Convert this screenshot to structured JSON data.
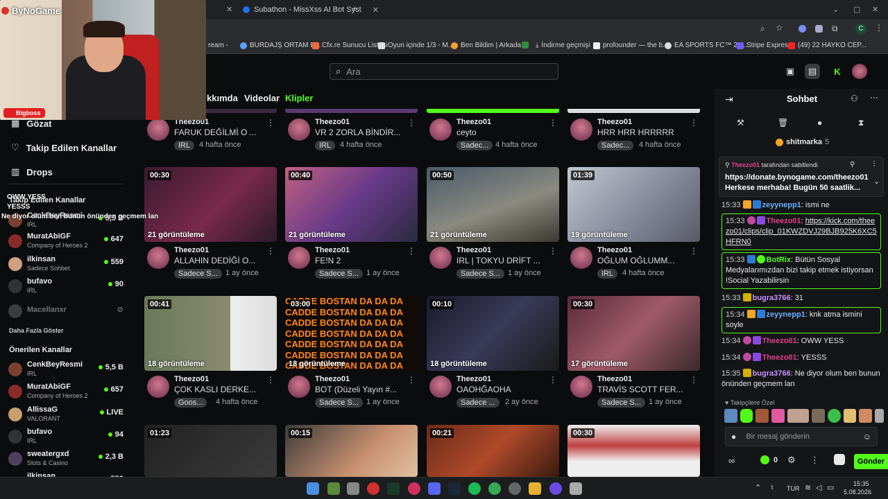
{
  "browser": {
    "tabs": [
      {
        "label": "Subathon - MissXss AI Bot Syst"
      }
    ],
    "new_tab": "+",
    "bookmarks": [
      "ream -",
      "BURDAJŞ ORTAM B...",
      "Cfx.re Sunucu Listesi",
      "Oyun içinde 1/3 - M...",
      "Ben Bildim | Arkada...",
      "İndirme geçmişi",
      "profounder — the b...",
      "EA SPORTS FC™ 24...",
      "Stripe Express",
      "(49) 22 HAYKO CEP..."
    ],
    "profile_letter": "C"
  },
  "header": {
    "search_placeholder": "Ara"
  },
  "overlay": {
    "logo": "ByNoGame",
    "webcam_name": "Bigboss",
    "chat_lines": [
      "OWW YESS",
      "YESSS",
      "Ne diyor olum ben bunun önünden geçmem lan"
    ]
  },
  "sidebar": {
    "nav": [
      {
        "label": "Gözat"
      },
      {
        "label": "Takip Edilen Kanallar"
      },
      {
        "label": "Drops"
      }
    ],
    "followed_heading": "Takip Edilen Kanallar",
    "followed": [
      {
        "name": "CenkBeyResmi",
        "category": "IRL",
        "viewers": "5,5 B"
      },
      {
        "name": "MuratAbiGF",
        "category": "Company of Heroes 2",
        "viewers": "647"
      },
      {
        "name": "ilkinsan",
        "category": "Sadece Sohbet",
        "viewers": "559"
      },
      {
        "name": "bufavo",
        "category": "IRL",
        "viewers": "90"
      },
      {
        "name": "Macellanxr",
        "category": "",
        "viewers": ""
      }
    ],
    "show_more": "Daha Fazla Göster",
    "recommended_heading": "Önerilen Kanallar",
    "recommended": [
      {
        "name": "CenkBeyResmi",
        "category": "IRL",
        "viewers": "5,5 B"
      },
      {
        "name": "MuratAbiGF",
        "category": "Company of Heroes 2",
        "viewers": "657"
      },
      {
        "name": "AllissaG",
        "category": "VALORANT",
        "viewers": "LIVE"
      },
      {
        "name": "bufavo",
        "category": "IRL",
        "viewers": "94"
      },
      {
        "name": "sweatergxd",
        "category": "Slots & Casino",
        "viewers": "2,3 B"
      },
      {
        "name": "ilkinsan",
        "category": "",
        "viewers": "559"
      }
    ]
  },
  "profile_tabs": {
    "about": "kkımda",
    "videos": "Videolar",
    "clips": "Klipler"
  },
  "clips": [
    {
      "duration": "",
      "views": "",
      "channel": "Theezo01",
      "title": "FARUK DEĞİLMİ O ...",
      "tag": "IRL",
      "age": "4 hafta önce"
    },
    {
      "duration": "",
      "views": "",
      "channel": "Theezo01",
      "title": "VR 2 ZORLA BİNDİR...",
      "tag": "IRL",
      "age": "4 hafta önce"
    },
    {
      "duration": "",
      "views": "",
      "channel": "Theezo01",
      "title": "ceyto",
      "tag": "Sadec...",
      "age": "4 hafta önce"
    },
    {
      "duration": "",
      "views": "",
      "channel": "Theezo01",
      "title": "HRR HRR HRRRRR",
      "tag": "Sadec...",
      "age": "4 hafta önce"
    },
    {
      "duration": "00:30",
      "views": "21 görüntüleme",
      "channel": "Theezo01",
      "title": "ALLAHIN DEDİĞİ O...",
      "tag": "Sadece S...",
      "age": "1 ay önce"
    },
    {
      "duration": "00:40",
      "views": "21 görüntüleme",
      "channel": "Theezo01",
      "title": "FE!N 2",
      "tag": "Sadece S...",
      "age": "1 ay önce"
    },
    {
      "duration": "00:50",
      "views": "21 görüntüleme",
      "channel": "Theezo01",
      "title": "IRL | TOKYU DRİFT ...",
      "tag": "Sadece S...",
      "age": "1 ay önce"
    },
    {
      "duration": "01:39",
      "views": "19 görüntüleme",
      "channel": "Theezo01",
      "title": "OĞLUM OĞLUMM...",
      "tag": "IRL",
      "age": "4 hafta önce"
    },
    {
      "duration": "00:41",
      "views": "18 görüntüleme",
      "channel": "Theezo01",
      "title": "ÇOK KASLI DERKE...",
      "tag": "Goos...",
      "age": "4 hafta önce"
    },
    {
      "duration": "03:00",
      "views": "18 görüntüleme",
      "channel": "Theezo01",
      "title": "BOT (Düzeli Yayın #...",
      "tag": "Sadece S...",
      "age": "1 ay önce"
    },
    {
      "duration": "00:10",
      "views": "18 görüntüleme",
      "channel": "Theezo01",
      "title": "OAOHĞAOHA",
      "tag": "Sadece ...",
      "age": "2 ay önce"
    },
    {
      "duration": "00:30",
      "views": "17 görüntüleme",
      "channel": "Theezo01",
      "title": "TRAVİS SCOTT FER...",
      "tag": "Sadece S...",
      "age": "1 ay önce"
    },
    {
      "duration": "01:23",
      "views": "",
      "channel": "",
      "title": "",
      "tag": "",
      "age": ""
    },
    {
      "duration": "00:15",
      "views": "",
      "channel": "",
      "title": "",
      "tag": "",
      "age": ""
    },
    {
      "duration": "00:21",
      "views": "",
      "channel": "",
      "title": "",
      "tag": "",
      "age": ""
    },
    {
      "duration": "00:30",
      "views": "",
      "channel": "",
      "title": "",
      "tag": "",
      "age": ""
    }
  ],
  "clip_text_overlay": "CADDE BOSTAN DA DA DA",
  "chat": {
    "title": "Sohbet",
    "top_gifter": {
      "name": "shitmarka",
      "count": "5"
    },
    "pinned": {
      "by": "Theezo01",
      "label": "tarafından sabitlendi",
      "text": "https://donate.bynogame.com/theezo01 Herkese merhaba! Bugün 50 saatlik..."
    },
    "messages": [
      {
        "time": "15:33",
        "user": "zeyynepp1",
        "text": "ismi ne",
        "color": "#6ab0ff"
      },
      {
        "time": "15:33",
        "user": "Theezo01",
        "text": "https://kick.com/theezo01/clips/clip_01KWZDVJ29BJB925K6XC5HFRN0",
        "color": "#e0408c"
      },
      {
        "time": "15:33",
        "user": "BotRix",
        "text": "Bütün Sosyal Medyalarımızdan bizi takip etmek istiyorsan !Social Yazabilirsin",
        "color": "#53fc18"
      },
      {
        "time": "15:33",
        "user": "bugra3766",
        "text": "31",
        "color": "#c992ff"
      },
      {
        "time": "15:34",
        "user": "zeyynepp1",
        "text": "knk atma ismini soyle",
        "color": "#6ab0ff"
      },
      {
        "time": "15:34",
        "user": "Theezo01",
        "text": "OWW YESS",
        "color": "#e0408c"
      },
      {
        "time": "15:34",
        "user": "Theezo01",
        "text": "YESSS",
        "color": "#e0408c"
      },
      {
        "time": "15:35",
        "user": "bugra3766",
        "text": "Ne diyor olum ben bunun önünden geçmem lan",
        "color": "#c992ff"
      }
    ],
    "emote_label": "Takipçilere Özel",
    "input_placeholder": "Bir mesaj gönderin",
    "points": "0",
    "send_label": "Gönder"
  },
  "taskbar": {
    "lang": "TUR",
    "time": "15:35",
    "date": "5.08.2026"
  }
}
